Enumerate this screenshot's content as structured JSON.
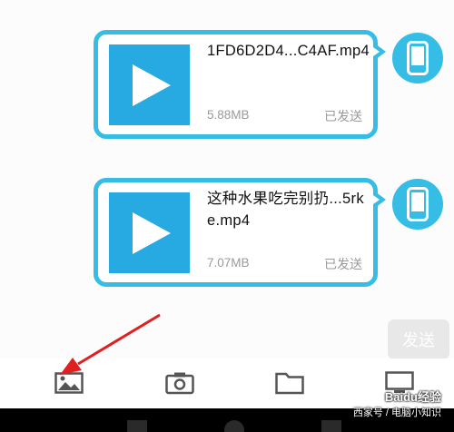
{
  "messages": [
    {
      "file_name": "1FD6D2D4...C4AF.mp4",
      "file_size": "5.88MB",
      "status": "已发送"
    },
    {
      "file_name": "这种水果吃完别扔...5rke.mp4",
      "file_size": "7.07MB",
      "status": "已发送"
    }
  ],
  "composer": {
    "send_label": "发送"
  },
  "toolbar": {
    "icons": [
      "image-icon",
      "camera-icon",
      "folder-icon",
      "screen-icon"
    ]
  },
  "watermark": {
    "line1": "Baidu经验",
    "line2": "西家号 / 电脑小知识"
  },
  "colors": {
    "accent": "#35bde6",
    "thumbnail": "#27a9e1",
    "arrow": "#e02020",
    "status_text": "#9a9a9a"
  }
}
